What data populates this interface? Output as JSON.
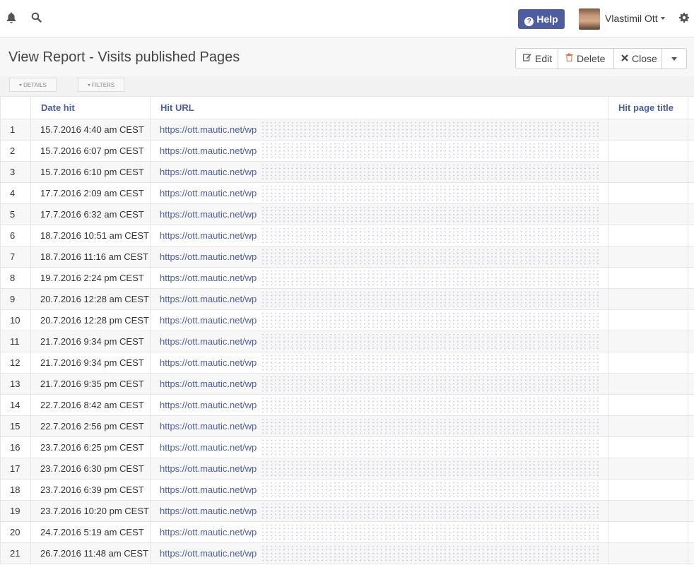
{
  "user": {
    "name": "Vlastimil Ott"
  },
  "help_label": "Help",
  "page": {
    "title": "View Report - Visits published Pages"
  },
  "actions": {
    "edit": "Edit",
    "delete": "Delete",
    "close": "Close"
  },
  "tabs": {
    "details": "Details",
    "filters": "Filters"
  },
  "table": {
    "headers": {
      "date": "Date hit",
      "url": "Hit URL",
      "title": "Hit page title"
    },
    "rows": [
      {
        "n": "1",
        "date": "15.7.2016 4:40 am CEST",
        "url": "https://ott.mautic.net/wp"
      },
      {
        "n": "2",
        "date": "15.7.2016 6:07 pm CEST",
        "url": "https://ott.mautic.net/wp"
      },
      {
        "n": "3",
        "date": "15.7.2016 6:10 pm CEST",
        "url": "https://ott.mautic.net/wp"
      },
      {
        "n": "4",
        "date": "17.7.2016 2:09 am CEST",
        "url": "https://ott.mautic.net/wp"
      },
      {
        "n": "5",
        "date": "17.7.2016 6:32 am CEST",
        "url": "https://ott.mautic.net/wp"
      },
      {
        "n": "6",
        "date": "18.7.2016 10:51 am CEST",
        "url": "https://ott.mautic.net/wp"
      },
      {
        "n": "7",
        "date": "18.7.2016 11:16 am CEST",
        "url": "https://ott.mautic.net/wp"
      },
      {
        "n": "8",
        "date": "19.7.2016 2:24 pm CEST",
        "url": "https://ott.mautic.net/wp"
      },
      {
        "n": "9",
        "date": "20.7.2016 12:28 am CEST",
        "url": "https://ott.mautic.net/wp"
      },
      {
        "n": "10",
        "date": "20.7.2016 12:28 pm CEST",
        "url": "https://ott.mautic.net/wp"
      },
      {
        "n": "11",
        "date": "21.7.2016 9:34 pm CEST",
        "url": "https://ott.mautic.net/wp"
      },
      {
        "n": "12",
        "date": "21.7.2016 9:34 pm CEST",
        "url": "https://ott.mautic.net/wp"
      },
      {
        "n": "13",
        "date": "21.7.2016 9:35 pm CEST",
        "url": "https://ott.mautic.net/wp"
      },
      {
        "n": "14",
        "date": "22.7.2016 8:42 am CEST",
        "url": "https://ott.mautic.net/wp"
      },
      {
        "n": "15",
        "date": "22.7.2016 2:56 pm CEST",
        "url": "https://ott.mautic.net/wp"
      },
      {
        "n": "16",
        "date": "23.7.2016 6:25 pm CEST",
        "url": "https://ott.mautic.net/wp"
      },
      {
        "n": "17",
        "date": "23.7.2016 6:30 pm CEST",
        "url": "https://ott.mautic.net/wp"
      },
      {
        "n": "18",
        "date": "23.7.2016 6:39 pm CEST",
        "url": "https://ott.mautic.net/wp"
      },
      {
        "n": "19",
        "date": "23.7.2016 10:20 pm CEST",
        "url": "https://ott.mautic.net/wp"
      },
      {
        "n": "20",
        "date": "24.7.2016 5:19 am CEST",
        "url": "https://ott.mautic.net/wp"
      },
      {
        "n": "21",
        "date": "26.7.2016 11:48 am CEST",
        "url": "https://ott.mautic.net/wp"
      }
    ]
  }
}
